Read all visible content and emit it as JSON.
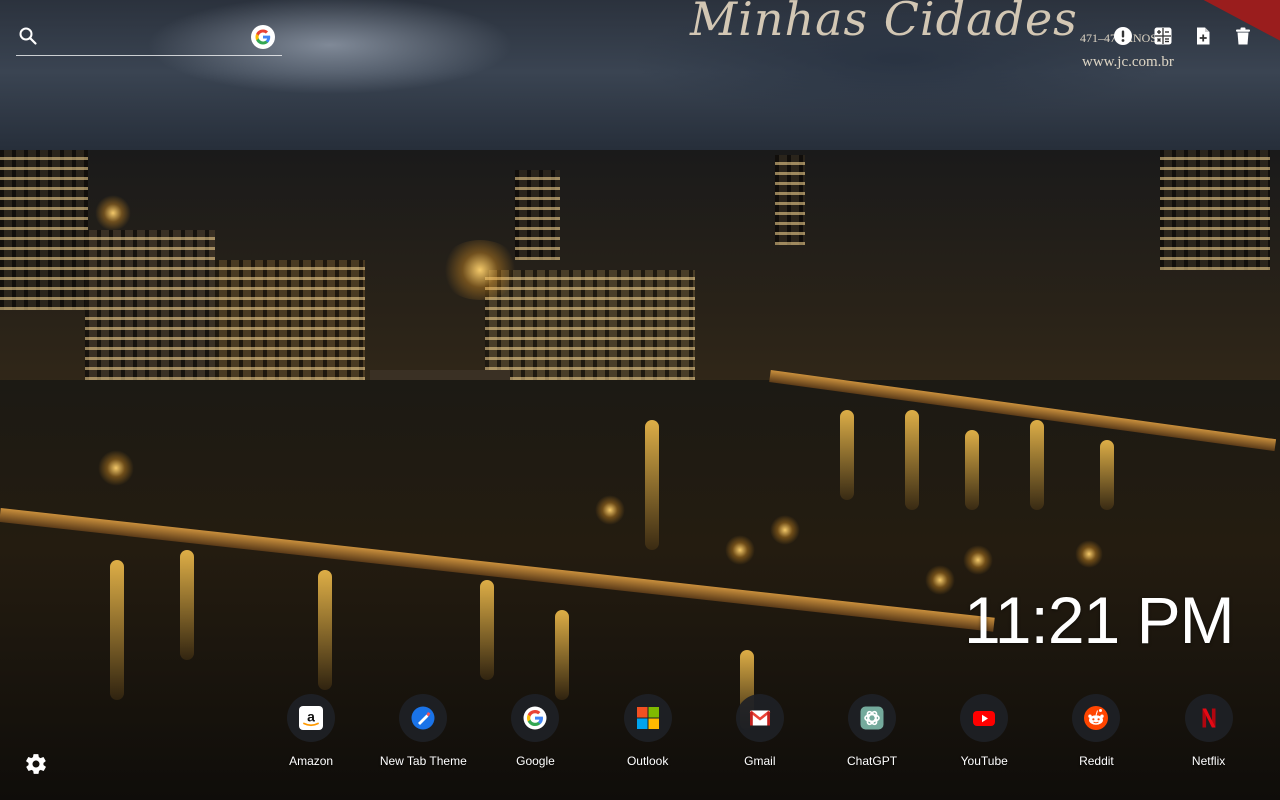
{
  "wallpaper": {
    "watermark_title": "Minhas Cidades",
    "watermark_years": "471–479 ANOS",
    "watermark_url": "www.jc.com.br"
  },
  "search": {
    "placeholder": "",
    "value": "",
    "icon": "search-icon",
    "engine_icon": "google-icon"
  },
  "toolbar": {
    "items": [
      {
        "name": "info-icon"
      },
      {
        "name": "calculator-icon"
      },
      {
        "name": "new-file-icon"
      },
      {
        "name": "trash-icon"
      }
    ]
  },
  "clock": {
    "time": "11:21 PM"
  },
  "shortcuts": [
    {
      "label": "Amazon",
      "icon": "amazon-icon"
    },
    {
      "label": "New Tab Theme",
      "icon": "new-tab-theme-icon"
    },
    {
      "label": "Google",
      "icon": "google-icon"
    },
    {
      "label": "Outlook",
      "icon": "outlook-icon"
    },
    {
      "label": "Gmail",
      "icon": "gmail-icon"
    },
    {
      "label": "ChatGPT",
      "icon": "chatgpt-icon"
    },
    {
      "label": "YouTube",
      "icon": "youtube-icon"
    },
    {
      "label": "Reddit",
      "icon": "reddit-icon"
    },
    {
      "label": "Netflix",
      "icon": "netflix-icon"
    }
  ],
  "settings": {
    "icon": "gear-icon"
  },
  "colors": {
    "dock_circle": "#1e2126",
    "text": "#ffffff",
    "youtube": "#ff0000",
    "reddit": "#ff4500",
    "netflix": "#e50914"
  }
}
